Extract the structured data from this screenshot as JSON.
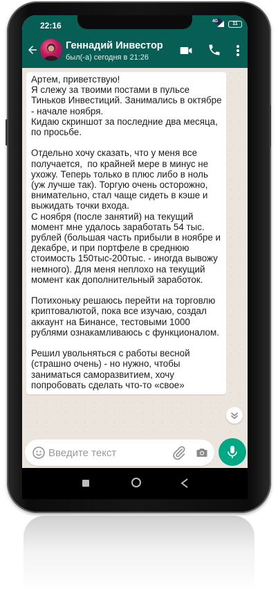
{
  "status_bar": {
    "time": "22:16",
    "network": "4G",
    "battery": "11"
  },
  "chat_header": {
    "contact_name": "Геннадий Инвестор",
    "last_seen": "был(-а) сегодня в 21:26"
  },
  "icons": {
    "back": "arrow-left-icon",
    "video": "video-camera-icon",
    "call": "phone-icon",
    "menu": "more-vertical-icon",
    "emoji": "emoji-icon",
    "attach": "paperclip-icon",
    "camera": "camera-icon",
    "mic": "microphone-icon",
    "scroll": "chevron-double-down-icon"
  },
  "colors": {
    "header": "#075e54",
    "accent": "#00a884",
    "chat_background": "#ece5dd",
    "bubble": "#ffffff"
  },
  "message": {
    "text": "Артем, приветствую!\nЯ слежу за твоими постами в пульсе Тиньков Инвестиций. Занимались в октябре - начале ноября.\nКидаю скриншот за последние два месяца, по просьбе.\n\nОтдельно хочу сказать, что у меня все получается,  по крайней мере в минус не ухожу. Теперь только в плюс либо в ноль (уж лучше так). Торгую очень осторожно, внимательно, стал чаще сидеть в кэше и выжидать точки входа.\nС ноября (после занятий) на текущий момент мне удалось заработать 54 тыс. рублей (большая часть прибыли в ноябре и декабре, и при портфеле в среднюю стоимость 150тыс-200тыс. - иногда вывожу немного). Для меня неплохо на текущий момент как дополнительный заработок.\n\nПотихоньку решаюсь перейти на торговлю криптовалютой, пока все изучаю, создал аккаунт на Бинансе, тестовыми 1000 рублями ознакамливаюсь с функционалом.\n\nРешил увольняться с работы весной (страшно очень) - но нужно, чтобы заниматься саморазвитием, хочу попробовать сделать что-то «свое»"
  },
  "composer": {
    "placeholder": "Введите текст",
    "value": ""
  }
}
